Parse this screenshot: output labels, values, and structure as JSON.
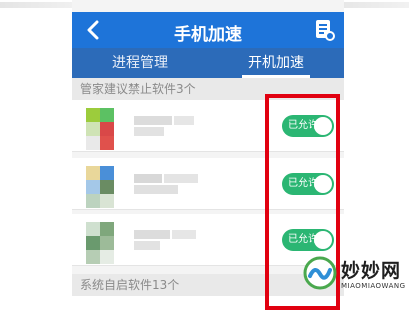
{
  "header": {
    "title": "手机加速",
    "back_icon": "chevron-left-icon",
    "menu_icon": "document-icon",
    "bar_color": "#1e74d9"
  },
  "tabs": [
    {
      "label": "进程管理",
      "active": false
    },
    {
      "label": "开机加速",
      "active": true
    }
  ],
  "sections": {
    "recommended": "管家建议禁止软件3个",
    "system": "系统自启软件13个"
  },
  "apps": [
    {
      "name": "",
      "toggle_label": "已允许",
      "enabled": true
    },
    {
      "name": "",
      "toggle_label": "已允许",
      "enabled": true
    },
    {
      "name": "",
      "toggle_label": "已允许",
      "enabled": true
    }
  ],
  "colors": {
    "toggle_on": "#2bb673",
    "highlight": "#e10010"
  },
  "watermark": {
    "name": "妙妙网",
    "sub": "MIAOMIAOWANG"
  }
}
